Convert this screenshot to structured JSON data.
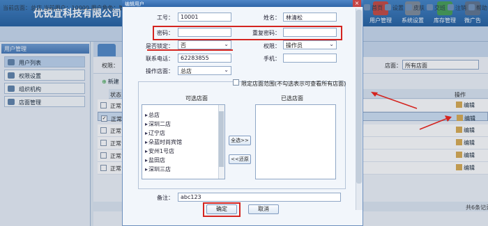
{
  "header": {
    "company": "优锐宜科技有限公司",
    "nav": [
      {
        "label": "用户管理",
        "icon": "user-manage-icon",
        "color": "#c4423a"
      },
      {
        "label": "系统设置",
        "icon": "system-settings-icon",
        "color": "#7a8896"
      },
      {
        "label": "库存管理",
        "icon": "inventory-icon",
        "color": "#3f9a4f"
      },
      {
        "label": "微广告",
        "icon": "ads-icon",
        "color": "#5a6f8a"
      }
    ]
  },
  "infobar": {
    "text": "当前店面：总店   当前用户：10000   用户角色：管",
    "tools": [
      "首页",
      "设置",
      "皮肤",
      "交班",
      "注销",
      "帮助"
    ]
  },
  "sidebar": {
    "title": "用户管理",
    "items": [
      {
        "label": "用户列表",
        "icon": "user-list-icon",
        "active": true
      },
      {
        "label": "权限设置",
        "icon": "permission-icon",
        "active": false
      },
      {
        "label": "组织机构",
        "icon": "org-icon",
        "active": false
      },
      {
        "label": "店面管理",
        "icon": "store-icon",
        "active": false
      }
    ]
  },
  "main": {
    "perm_label": "权限：",
    "store_label": "店面：",
    "store_value": "所有店面",
    "new_label": "新建",
    "col_status": "状态",
    "col_op": "操作",
    "rows": [
      {
        "status": "正常",
        "checked": false,
        "edit": "编辑"
      },
      {
        "status": "正常",
        "checked": true,
        "edit": "编辑"
      },
      {
        "status": "正常",
        "checked": false,
        "edit": "编辑"
      },
      {
        "status": "正常",
        "checked": false,
        "edit": "编辑"
      },
      {
        "status": "正常",
        "checked": false,
        "edit": "编辑"
      },
      {
        "status": "正常",
        "checked": false,
        "edit": "编辑"
      }
    ],
    "page_info": "共6条记录"
  },
  "dialog": {
    "title": "编辑用户",
    "close": "×",
    "fields": {
      "job_no_label": "工号：",
      "job_no": "10001",
      "name_label": "姓名：",
      "name": "林清松",
      "password_label": "密码：",
      "password": "",
      "repeat_password_label": "重复密码：",
      "repeat_password": "",
      "locked_label": "是否锁定：",
      "locked": "否",
      "permission_label": "权限：",
      "permission": "操作员",
      "phone_label": "联系电话：",
      "phone": "62283855",
      "mobile_label": "手机：",
      "mobile": "",
      "op_store_label": "操作店面：",
      "op_store": "总店"
    },
    "scope": {
      "check_label": "限定店面范围(不勾选表示可查看所有店面)",
      "available_title": "可选店面",
      "selected_title": "已选店面",
      "available": [
        "总店",
        "深圳二店",
        "辽宁店",
        "朵蓝时尚宾馆",
        "安州1号店",
        "盐田店",
        "深圳三店"
      ],
      "select_all_btn": "全选>>",
      "restore_btn": "<<还原"
    },
    "remark_label": "备注：",
    "remark": "abc123",
    "ok": "确定",
    "cancel": "取消"
  },
  "colors": {
    "annotation_red": "#d4241f",
    "header_blue": "#2f66a8"
  }
}
